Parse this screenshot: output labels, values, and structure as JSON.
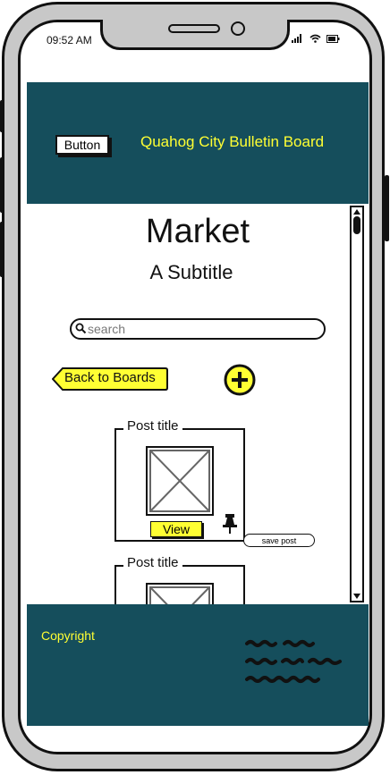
{
  "status_bar": {
    "time": "09:52 AM"
  },
  "header": {
    "button_label": "Button",
    "title": "Quahog City Bulletin Board"
  },
  "page": {
    "title": "Market",
    "subtitle": "A Subtitle"
  },
  "search": {
    "placeholder": "search",
    "value": ""
  },
  "actions": {
    "back_label": "Back to Boards"
  },
  "posts": [
    {
      "title": "Post title",
      "view_label": "View",
      "save_label": "save post"
    },
    {
      "title": "Post title"
    }
  ],
  "footer": {
    "copyright": "Copyright"
  },
  "colors": {
    "header_bg": "#154e5c",
    "accent_yellow": "#ffff33"
  },
  "icons": [
    "search-icon",
    "add-icon",
    "pin-icon",
    "image-placeholder-icon",
    "wifi-icon",
    "signal-icon",
    "battery-icon"
  ]
}
